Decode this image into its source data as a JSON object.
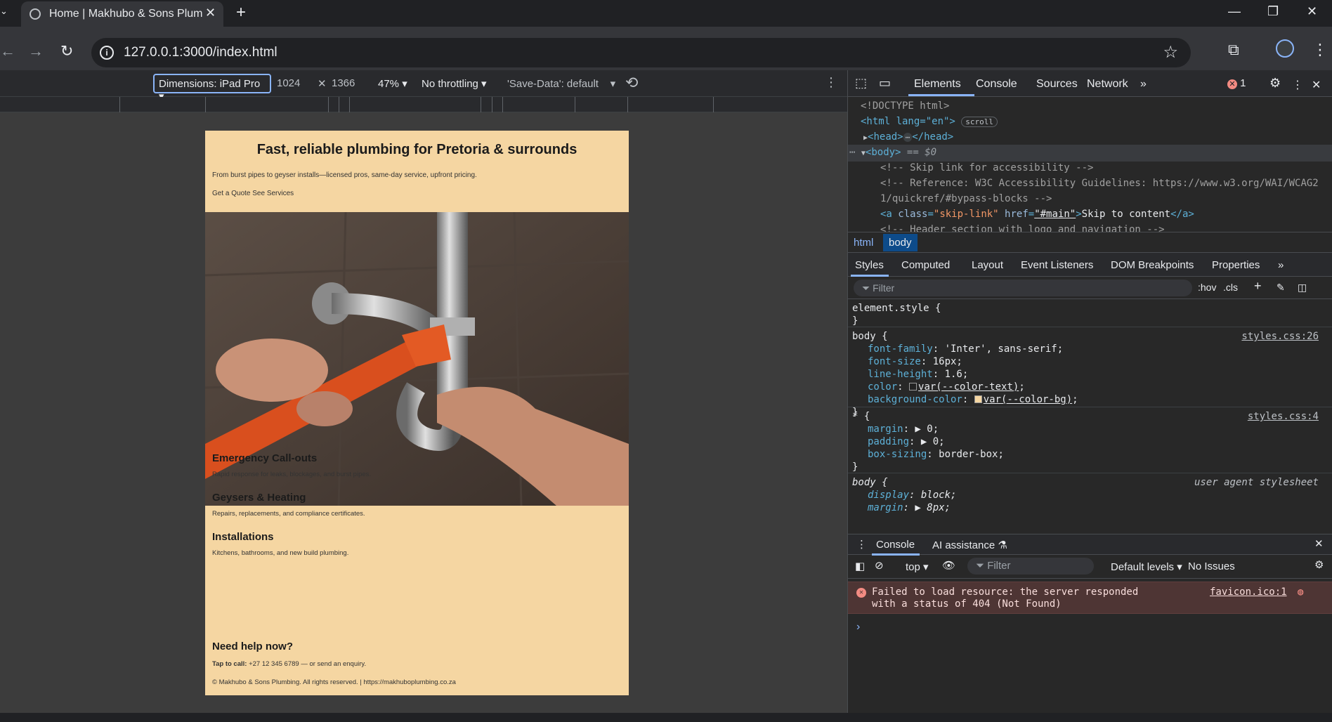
{
  "browser": {
    "tab_title": "Home | Makhubo & Sons Plumbing",
    "url": "127.0.0.1:3000/index.html"
  },
  "device_toolbar": {
    "dimensions": "Dimensions: iPad Pro",
    "width": "1024",
    "height": "1366",
    "zoom": "47%",
    "throttling": "No throttling",
    "save_data": "'Save-Data': default"
  },
  "site": {
    "hero_title": "Fast, reliable plumbing for Pretoria & surrounds",
    "hero_sub": "From burst pipes to geyser installs—licensed pros, same-day service, upfront pricing.",
    "hero_cta": "Get a Quote See Services",
    "services": [
      {
        "title": "Emergency Call-outs",
        "desc": "Rapid response for leaks, blockages, and burst pipes."
      },
      {
        "title": "Geysers & Heating",
        "desc": "Repairs, replacements, and compliance certificates."
      },
      {
        "title": "Installations",
        "desc": "Kitchens, bathrooms, and new build plumbing."
      },
      {
        "title": "Need help now?",
        "desc": ""
      }
    ],
    "call_label": "Tap to call:",
    "call_text": " +27 12 345 6789 — or send an enquiry.",
    "footer": "© Makhubo & Sons Plumbing. All rights reserved. | https://makhuboplumbing.co.za"
  },
  "devtools": {
    "tabs": [
      "Elements",
      "Console",
      "Sources",
      "Network"
    ],
    "error_count": "1",
    "dom": {
      "doctype": "<!DOCTYPE html>",
      "html_open": "<html lang=\"en\">",
      "scroll_badge": "scroll",
      "head": "<head>",
      "head_close": "</head>",
      "body": "<body>",
      "body_eq": " == $0",
      "comment1": "<!-- Skip link for accessibility -->",
      "comment2a": "<!-- Reference: W3C Accessibility Guidelines: https://www.w3.org/WAI/WCAG2",
      "comment2b": "1/quickref/#bypass-blocks -->",
      "skip_link_text": "Skip to content",
      "comment3": "<!-- Header section with logo and navigation -->"
    },
    "breadcrumb": [
      "html",
      "body"
    ],
    "sub_tabs": [
      "Styles",
      "Computed",
      "Layout",
      "Event Listeners",
      "DOM Breakpoints",
      "Properties"
    ],
    "filter_placeholder": "Filter",
    "hov": ":hov",
    "cls": ".cls",
    "styles": {
      "element_style": "element.style {",
      "body_src": "styles.css:26",
      "star_src": "styles.css:4",
      "ua_src": "user agent stylesheet"
    },
    "drawer_tabs": [
      "Console",
      "AI assistance"
    ],
    "console_toolbar": {
      "context": "top",
      "filter": "Filter",
      "levels": "Default levels",
      "issues": "No Issues"
    },
    "console_error": {
      "message": "Failed to load resource: the server responded with a status of 404 (Not Found)",
      "source": "favicon.ico:1"
    }
  }
}
